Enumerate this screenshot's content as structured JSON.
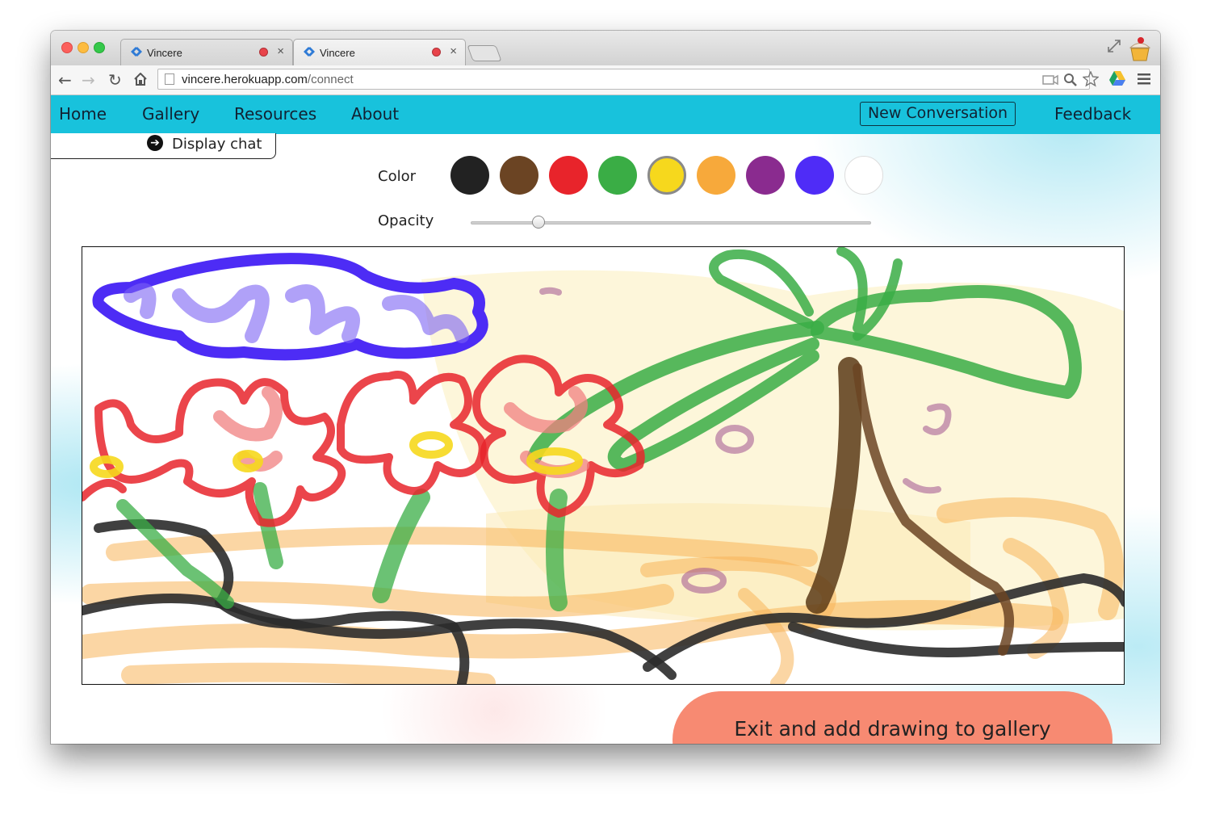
{
  "browser": {
    "tabs": [
      {
        "title": "Vincere",
        "active": false
      },
      {
        "title": "Vincere",
        "active": true
      }
    ],
    "url_host": "vincere.herokuapp.com",
    "url_path": "/connect"
  },
  "nav": {
    "home": "Home",
    "gallery": "Gallery",
    "resources": "Resources",
    "about": "About",
    "new_conversation": "New Conversation",
    "feedback": "Feedback"
  },
  "chat": {
    "toggle_label": "Display chat"
  },
  "tools": {
    "color_label": "Color",
    "opacity_label": "Opacity",
    "opacity_value": 0.17,
    "colors": [
      "#222222",
      "#6b4423",
      "#e8242b",
      "#3aad45",
      "#f6d81d",
      "#f7a93b",
      "#8a2b8f",
      "#4f2cf7",
      "#ffffff"
    ],
    "selected_color": "#f6d81d"
  },
  "actions": {
    "exit_label": "Exit and add drawing to gallery"
  },
  "icons": {
    "back": "back-arrow-icon",
    "forward": "forward-arrow-icon",
    "reload": "reload-icon",
    "home": "home-icon",
    "chat_toggle": "arrow-circle-right-icon"
  }
}
